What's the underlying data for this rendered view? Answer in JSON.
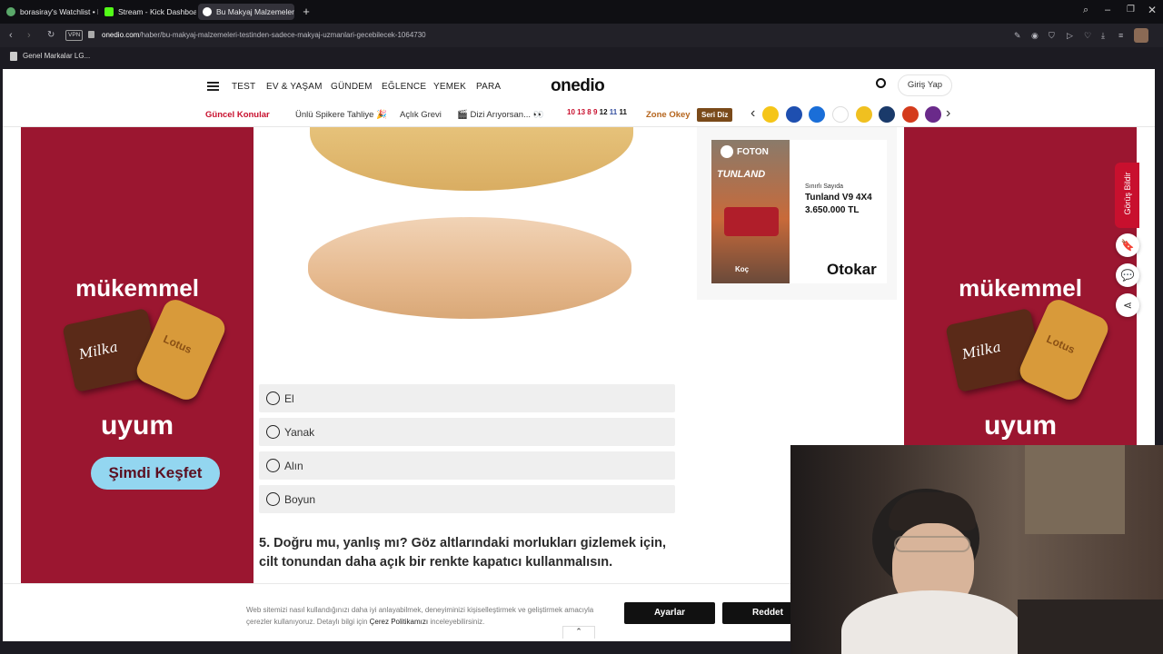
{
  "browser": {
    "tabs": [
      {
        "label": "borasiray's Watchlist • Let"
      },
      {
        "label": "Stream - Kick Dashboard"
      },
      {
        "label": "Bu Makyaj Malzemeleri Te"
      }
    ],
    "new_tab": "+",
    "vpn": "VPN",
    "url_host": "onedio.com",
    "url_path": "/haber/bu-makyaj-malzemeleri-testinden-sadece-makyaj-uzmanlari-gecebilecek-1064730",
    "bookmark": "Genel Markalar LG..."
  },
  "site": {
    "logo": "onedio",
    "nav": [
      "TEST",
      "EV & YAŞAM",
      "GÜNDEM",
      "EĞLENCE",
      "YEMEK",
      "PARA"
    ],
    "login": "Giriş Yap",
    "topics_label": "Güncel Konular",
    "topics": [
      "Ünlü Spikere Tahliye 🎉",
      "Açlık Grevi",
      "🎬 Dizi Arıyorsan... 👀"
    ],
    "promo_numbers": [
      "10",
      "13",
      "8",
      "9",
      "12",
      "11",
      "11"
    ],
    "zone": "Zone Okey",
    "seri_diz": "Seri Diz",
    "prev_arrow": "‹",
    "next_arrow": "›"
  },
  "ad_left": {
    "headline": "mükemmel",
    "footer": "uyum",
    "button": "Şimdi Keşfet",
    "brand1": "Milka",
    "brand2": "Lotus"
  },
  "ad_right": {
    "headline": "mükemmel",
    "footer": "uyum",
    "brand1": "Milka",
    "brand2": "Lotus"
  },
  "ad_car": {
    "brand": "FOTON",
    "model": "TUNLAND",
    "line1": "Sınırlı Sayıda",
    "line2": "Tunland V9 4X4",
    "line3": "3.650.000 TL",
    "dealer": "Otokar",
    "group": "Koç"
  },
  "quiz": {
    "options": [
      {
        "label": "El"
      },
      {
        "label": "Yanak"
      },
      {
        "label": "Alın"
      },
      {
        "label": "Boyun"
      }
    ],
    "question": "5. Doğru mu, yanlış mı? Göz altlarındaki morlukları gizlemek için, cilt tonundan daha açık bir renkte kapatıcı kullanmalısın."
  },
  "feedback": "Görüş Bildir",
  "cookie": {
    "text1": "Web sitemizi nasıl kullandığınızı daha iyi anlayabilmek, deneyiminizi kişiselleştirmek ve geliştirmek amacıyla",
    "text2": "çerezler kullanıyoruz. Detaylı bilgi için",
    "link": "Çerez Politikamızı",
    "text3": "inceleyebilirsiniz.",
    "settings": "Ayarlar",
    "reject": "Reddet"
  },
  "colors": {
    "ad_bg": "#9b1630",
    "accent": "#c8102e",
    "option_bg": "#efefef"
  }
}
